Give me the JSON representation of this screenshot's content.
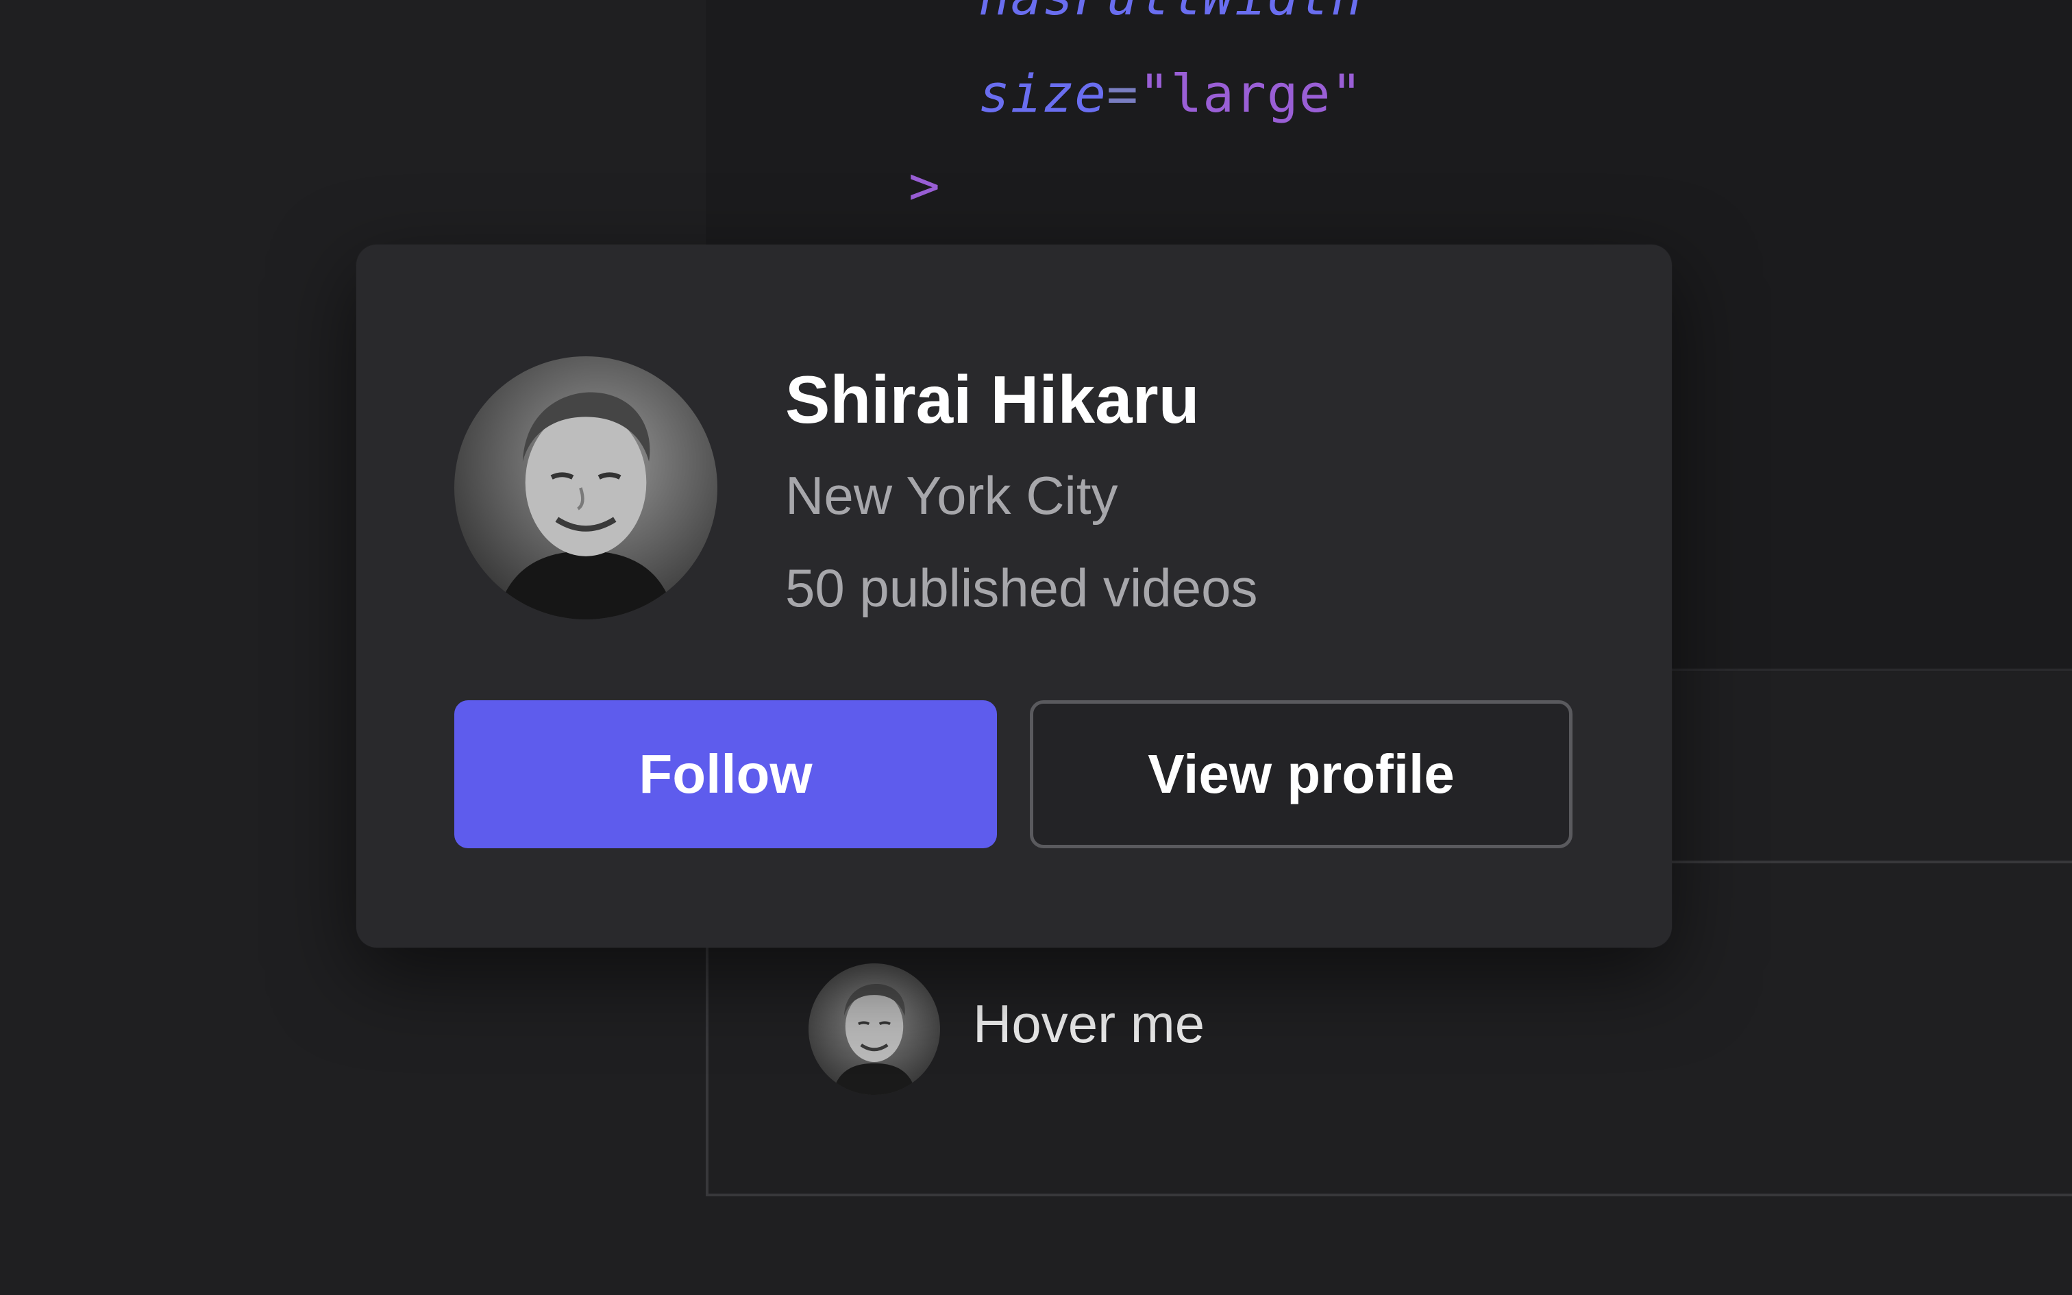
{
  "code": {
    "line1_attr": "hasFullWidth",
    "line2_attr": "size",
    "line2_eq": "=",
    "line2_value": "\"large\"",
    "line3_tag": ">"
  },
  "card": {
    "name": "Shirai Hikaru",
    "location": "New York City",
    "videos": "50 published videos",
    "follow_label": "Follow",
    "view_profile_label": "View profile"
  },
  "preview": {
    "hover_label": "Hover me"
  },
  "colors": {
    "accent": "#5e5ced",
    "background": "#1f1f21",
    "card": "#29292c"
  }
}
